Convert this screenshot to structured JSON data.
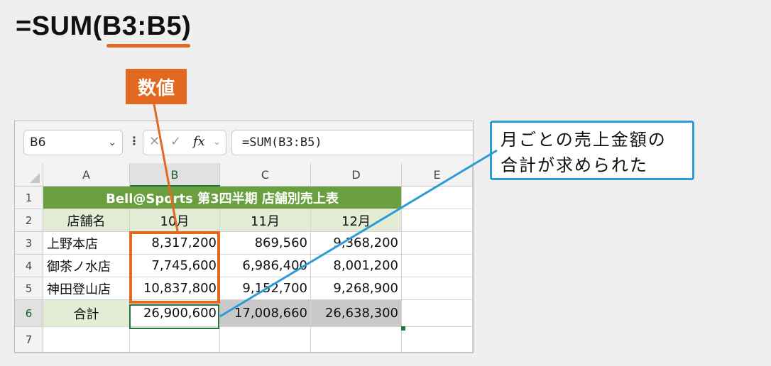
{
  "header": {
    "formula": "=SUM(B3:B5)"
  },
  "callouts": {
    "value_label": "数値",
    "result_line1": "月ごとの売上金額の",
    "result_line2": "合計が求められた"
  },
  "formula_bar": {
    "name_box": "B6",
    "formula": "=SUM(B3:B5)",
    "fx_label": "fx"
  },
  "icons": {
    "name_box_dropdown": "chevron-down-icon",
    "more": "more-vertical-icon",
    "cancel": "close-icon",
    "enter": "checkmark-icon",
    "function": "fx-icon"
  },
  "colors": {
    "accent_orange": "#e2691f",
    "callout_blue": "#2e9bd6",
    "header_green": "#6a9f3f",
    "light_green": "#e3edd6",
    "selection_green": "#1e7a3c"
  },
  "sheet": {
    "columns": [
      "A",
      "B",
      "C",
      "D",
      "E"
    ],
    "rows": [
      "1",
      "2",
      "3",
      "4",
      "5",
      "6",
      "7"
    ],
    "table_title": "Bell@Sports 第3四半期 店舗別売上表",
    "header_row": [
      "店舗名",
      "10月",
      "11月",
      "12月"
    ],
    "data_rows": [
      [
        "上野本店",
        "8,317,200",
        "869,560",
        "9,368,200"
      ],
      [
        "御茶ノ水店",
        "7,745,600",
        "6,986,400",
        "8,001,200"
      ],
      [
        "神田登山店",
        "10,837,800",
        "9,152,700",
        "9,268,900"
      ]
    ],
    "total_row": [
      "合計",
      "26,900,600",
      "17,008,660",
      "26,638,300"
    ],
    "active_cell": "B6"
  }
}
